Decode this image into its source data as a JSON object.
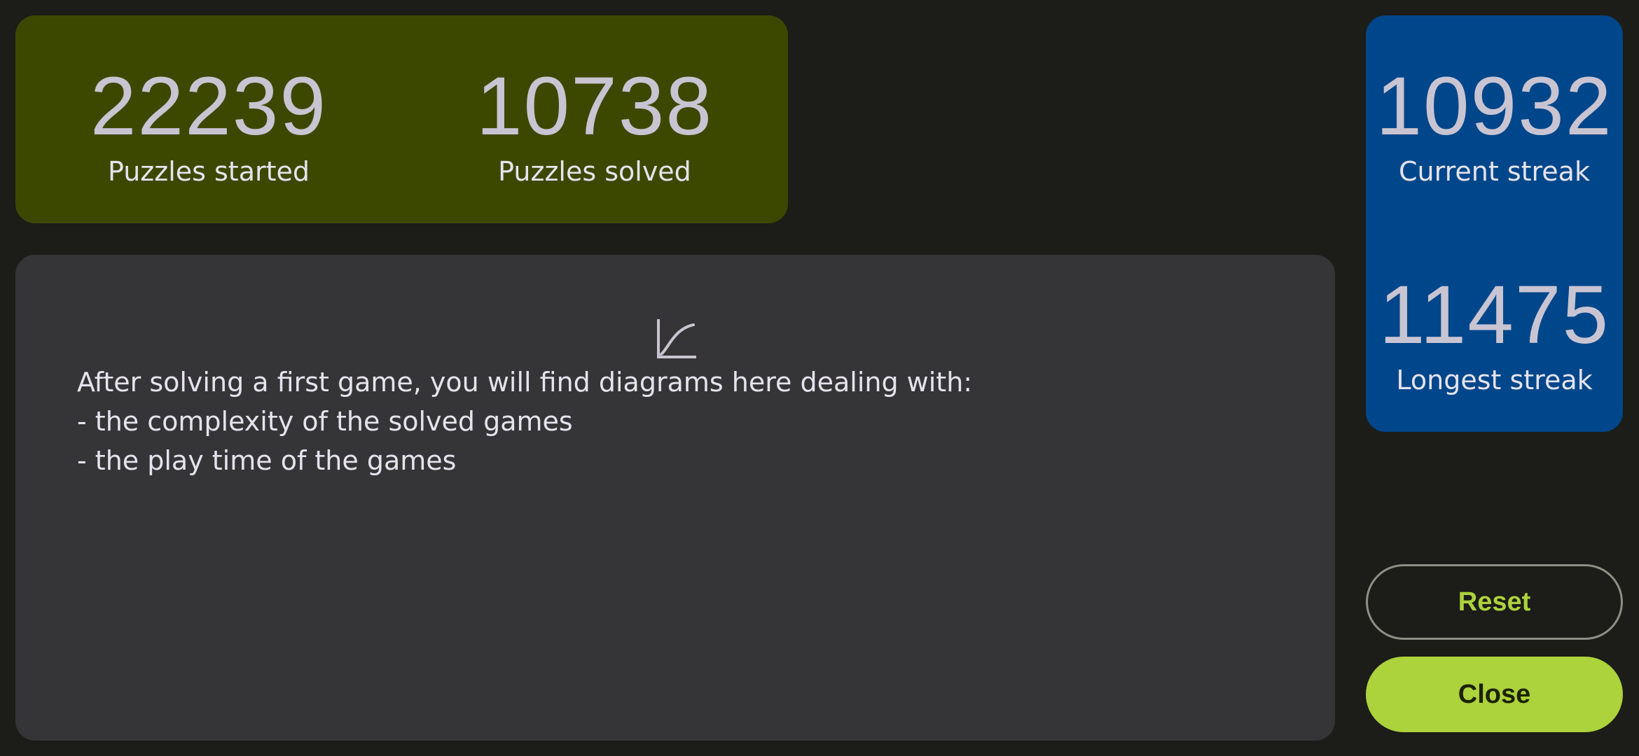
{
  "summary": {
    "started": {
      "value": "22239",
      "label": "Puzzles started"
    },
    "solved": {
      "value": "10738",
      "label": "Puzzles solved"
    }
  },
  "streaks": {
    "current": {
      "value": "10932",
      "label": "Current streak"
    },
    "longest": {
      "value": "11475",
      "label": "Longest streak"
    }
  },
  "diagrams": {
    "icon": "chart-icon",
    "lines": [
      "After solving a first game, you will find diagrams here dealing with:",
      "- the complexity of the solved games",
      "- the play time of the games"
    ]
  },
  "actions": {
    "reset_label": "Reset",
    "close_label": "Close"
  },
  "colors": {
    "background": "#1c1c18",
    "summary_card": "#3c4800",
    "streak_card": "#00468a",
    "diagram_card": "#353538",
    "accent": "#acd23c"
  }
}
